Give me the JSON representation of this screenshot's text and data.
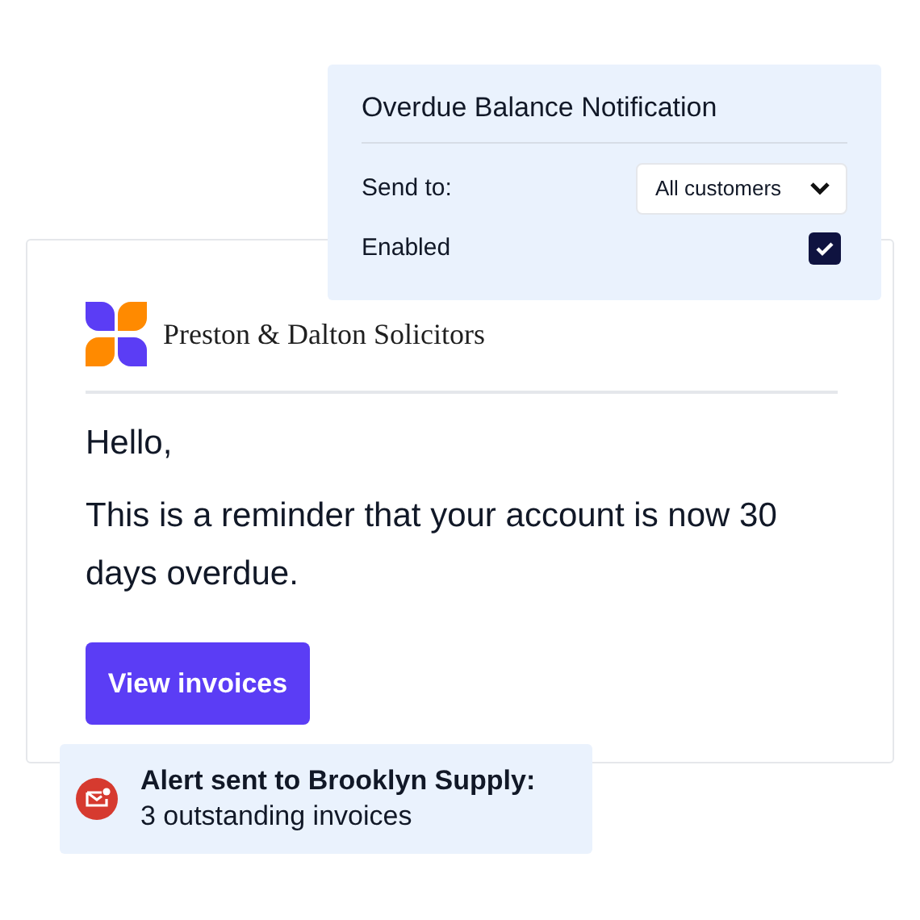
{
  "email": {
    "company": "Preston & Dalton Solicitors",
    "greeting": "Hello,",
    "message": "This is a reminder that your account is now 30 days overdue.",
    "button": "View invoices"
  },
  "settings": {
    "title": "Overdue Balance Notification",
    "send_to_label": "Send to:",
    "send_to_value": "All customers",
    "enabled_label": "Enabled",
    "enabled": true
  },
  "alert": {
    "title": "Alert sent to Brooklyn Supply:",
    "detail": "3 outstanding invoices"
  }
}
